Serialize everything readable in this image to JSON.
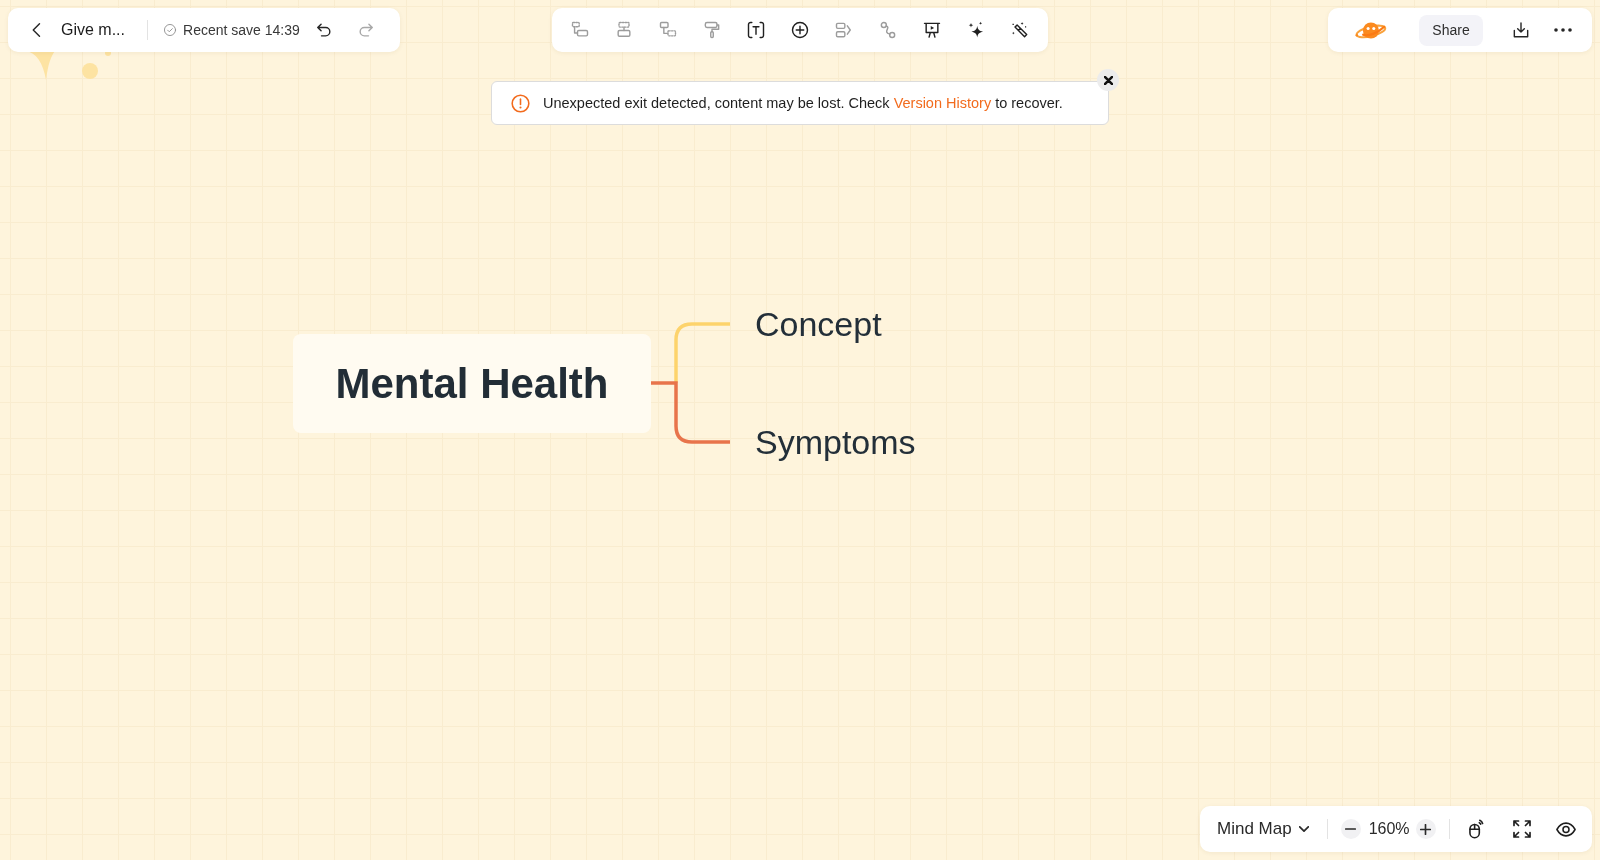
{
  "header": {
    "title": "Give m...",
    "save_status": "Recent save 14:39",
    "undo": {
      "disabled": false
    },
    "redo": {
      "disabled": true
    }
  },
  "toolbar": [
    {
      "kind": "branch",
      "disabled": true
    },
    {
      "kind": "stack",
      "disabled": true
    },
    {
      "kind": "link",
      "disabled": true
    },
    {
      "kind": "roller",
      "disabled": true
    },
    {
      "kind": "text",
      "disabled": false
    },
    {
      "kind": "plus",
      "disabled": false
    },
    {
      "kind": "tag",
      "disabled": true
    },
    {
      "kind": "path",
      "disabled": true
    },
    {
      "kind": "present",
      "disabled": false
    },
    {
      "kind": "sparkle",
      "disabled": false
    },
    {
      "kind": "wand",
      "disabled": false
    }
  ],
  "actions": {
    "share": "Share"
  },
  "alert": {
    "message_start": "Unexpected exit detected, content may be lost. Check",
    "link": "Version History",
    "message_end": "to recover."
  },
  "mind_map": {
    "root": "Mental Health",
    "children": [
      {
        "text": "Concept",
        "color": "#fdd36c"
      },
      {
        "text": "Symptoms",
        "color": "#e8744b"
      }
    ]
  },
  "view_bar": {
    "mode": "Mind Map",
    "zoom": "160%"
  }
}
